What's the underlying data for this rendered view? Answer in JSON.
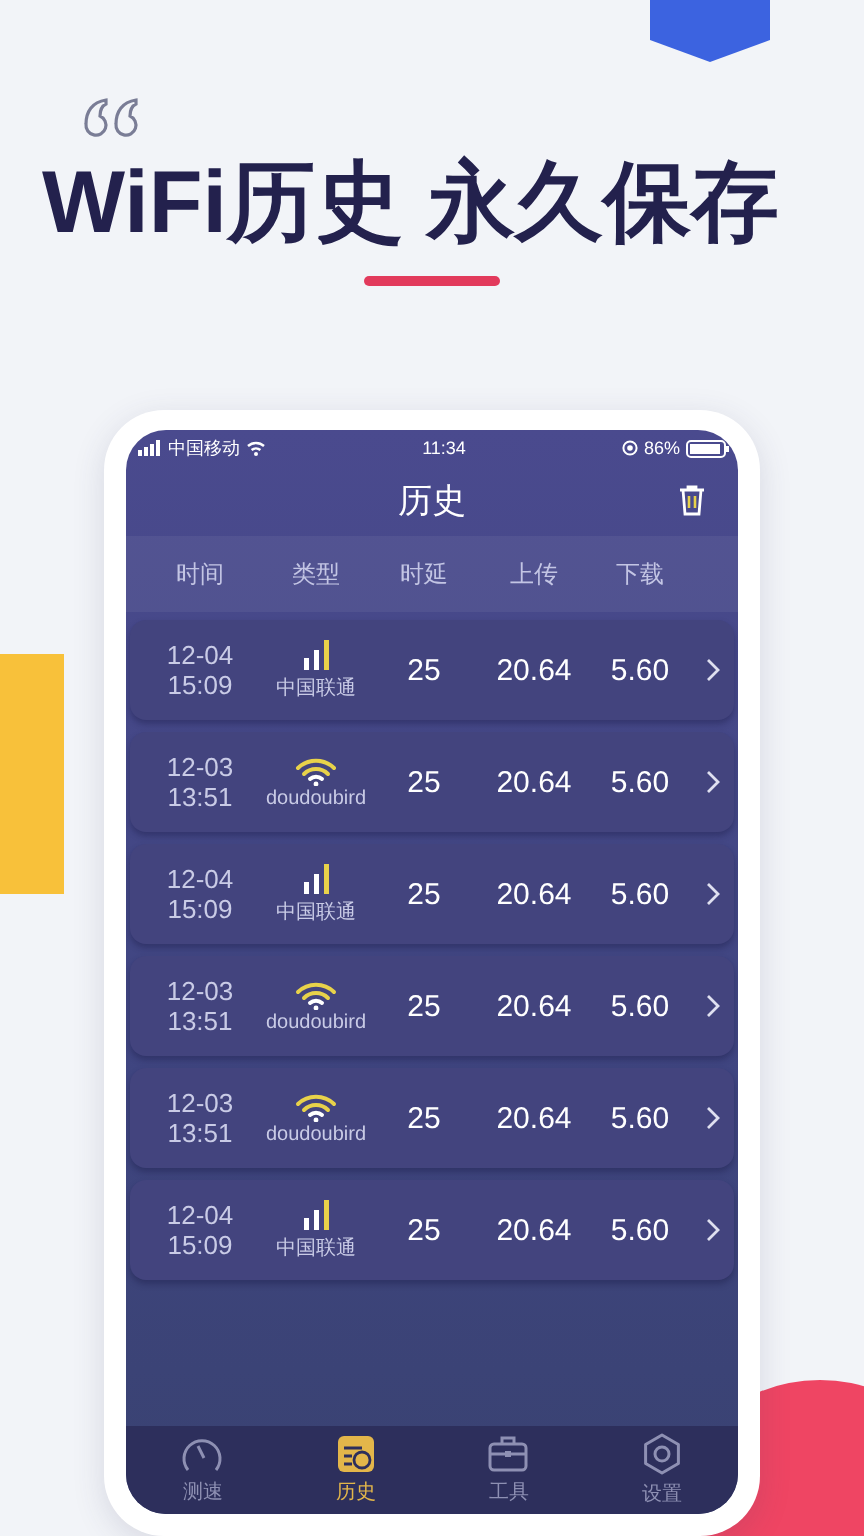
{
  "headline": "WiFi历史 永久保存",
  "status_bar": {
    "carrier": "中国移动",
    "time": "11:34",
    "battery": "86%"
  },
  "title": "历史",
  "columns": [
    "时间",
    "类型",
    "时延",
    "上传",
    "下载"
  ],
  "rows": [
    {
      "date": "12-04",
      "time": "15:09",
      "kind": "cellular",
      "network": "中国联通",
      "latency": "25",
      "upload": "20.64",
      "download": "5.60"
    },
    {
      "date": "12-03",
      "time": "13:51",
      "kind": "wifi",
      "network": "doudoubird",
      "latency": "25",
      "upload": "20.64",
      "download": "5.60"
    },
    {
      "date": "12-04",
      "time": "15:09",
      "kind": "cellular",
      "network": "中国联通",
      "latency": "25",
      "upload": "20.64",
      "download": "5.60"
    },
    {
      "date": "12-03",
      "time": "13:51",
      "kind": "wifi",
      "network": "doudoubird",
      "latency": "25",
      "upload": "20.64",
      "download": "5.60"
    },
    {
      "date": "12-03",
      "time": "13:51",
      "kind": "wifi",
      "network": "doudoubird",
      "latency": "25",
      "upload": "20.64",
      "download": "5.60"
    },
    {
      "date": "12-04",
      "time": "15:09",
      "kind": "cellular",
      "network": "中国联通",
      "latency": "25",
      "upload": "20.64",
      "download": "5.60"
    }
  ],
  "tabs": [
    {
      "label": "测速",
      "kind": "speed",
      "selected": false
    },
    {
      "label": "历史",
      "kind": "history",
      "selected": true
    },
    {
      "label": "工具",
      "kind": "tools",
      "selected": false
    },
    {
      "label": "设置",
      "kind": "settings",
      "selected": false
    }
  ]
}
